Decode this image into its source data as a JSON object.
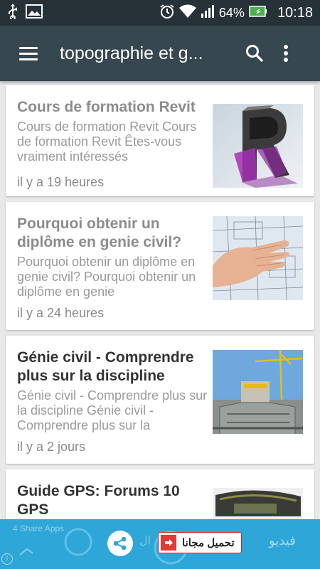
{
  "status_bar": {
    "battery": "64%",
    "time": "10:18",
    "icons_left": [
      "usb-icon",
      "image-icon"
    ],
    "icons_right": [
      "alarm-icon",
      "wifi-icon",
      "signal-icon",
      "battery-icon"
    ]
  },
  "toolbar": {
    "title": "topographie et g...",
    "background": "#37474f"
  },
  "articles": [
    {
      "title": "Cours de formation Revit",
      "snippet": "Cours de formation Revit Cours de formation Revit Êtes-vous vraiment intéressés",
      "time": "il y a 19 heures"
    },
    {
      "title": "Pourquoi obtenir un diplôme en genie civil?",
      "snippet": "Pourquoi obtenir un diplôme en genie civil? Pourquoi obtenir un diplôme en genie",
      "time": "il y a 24 heures"
    },
    {
      "title": "Génie civil - Comprendre plus sur la discipline",
      "snippet": "Génie civil - Comprendre plus sur la discipline Génie civil - Comprendre plus sur la",
      "time": "il y a 2 jours"
    },
    {
      "title": "Guide GPS: Forums 10 GPS",
      "snippet": "",
      "time": ""
    }
  ],
  "ad_banner": {
    "label": "4 Share Apps",
    "cta_label": "تحميل مجانا",
    "mid_text": "ال",
    "right_text": "فيديو",
    "info_icon": "i",
    "background": "#2fa6d8"
  }
}
